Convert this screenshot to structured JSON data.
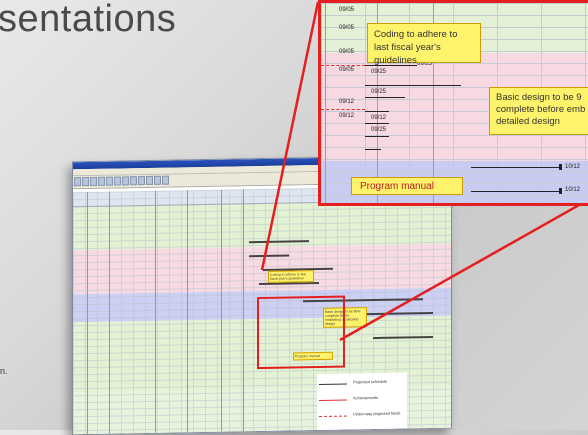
{
  "headline": "sentations",
  "footnote": "n.",
  "zoom_panel": {
    "note_top": "Coding to adhere to last fiscal year's guidelines",
    "note_right": "Basic design to be 9 complete before emb on detailed design",
    "program_manual": "Program manual",
    "dates": [
      "09/05",
      "09/05",
      "09/05",
      "09/05",
      "09/25",
      "09/25",
      "09/12",
      "09/25",
      "09/12",
      "09/12",
      "09/25",
      "10/12",
      "10/12"
    ]
  },
  "mini_sheet": {
    "note_top": "Coding to adhere to last fiscal year's guidelines",
    "note_right": "Basic design to be 90% complete before embarking on detailed design",
    "note_program": "Program manual",
    "legend": [
      "Projected schedule",
      "Achievements",
      "Under-way projected finish"
    ]
  },
  "colors": {
    "accent_red": "#e41f1f",
    "note_yellow": "#fff36b",
    "band_blue": "#c9cdf0",
    "band_pink": "#f6d7df",
    "band_green": "#e2f0cf"
  }
}
